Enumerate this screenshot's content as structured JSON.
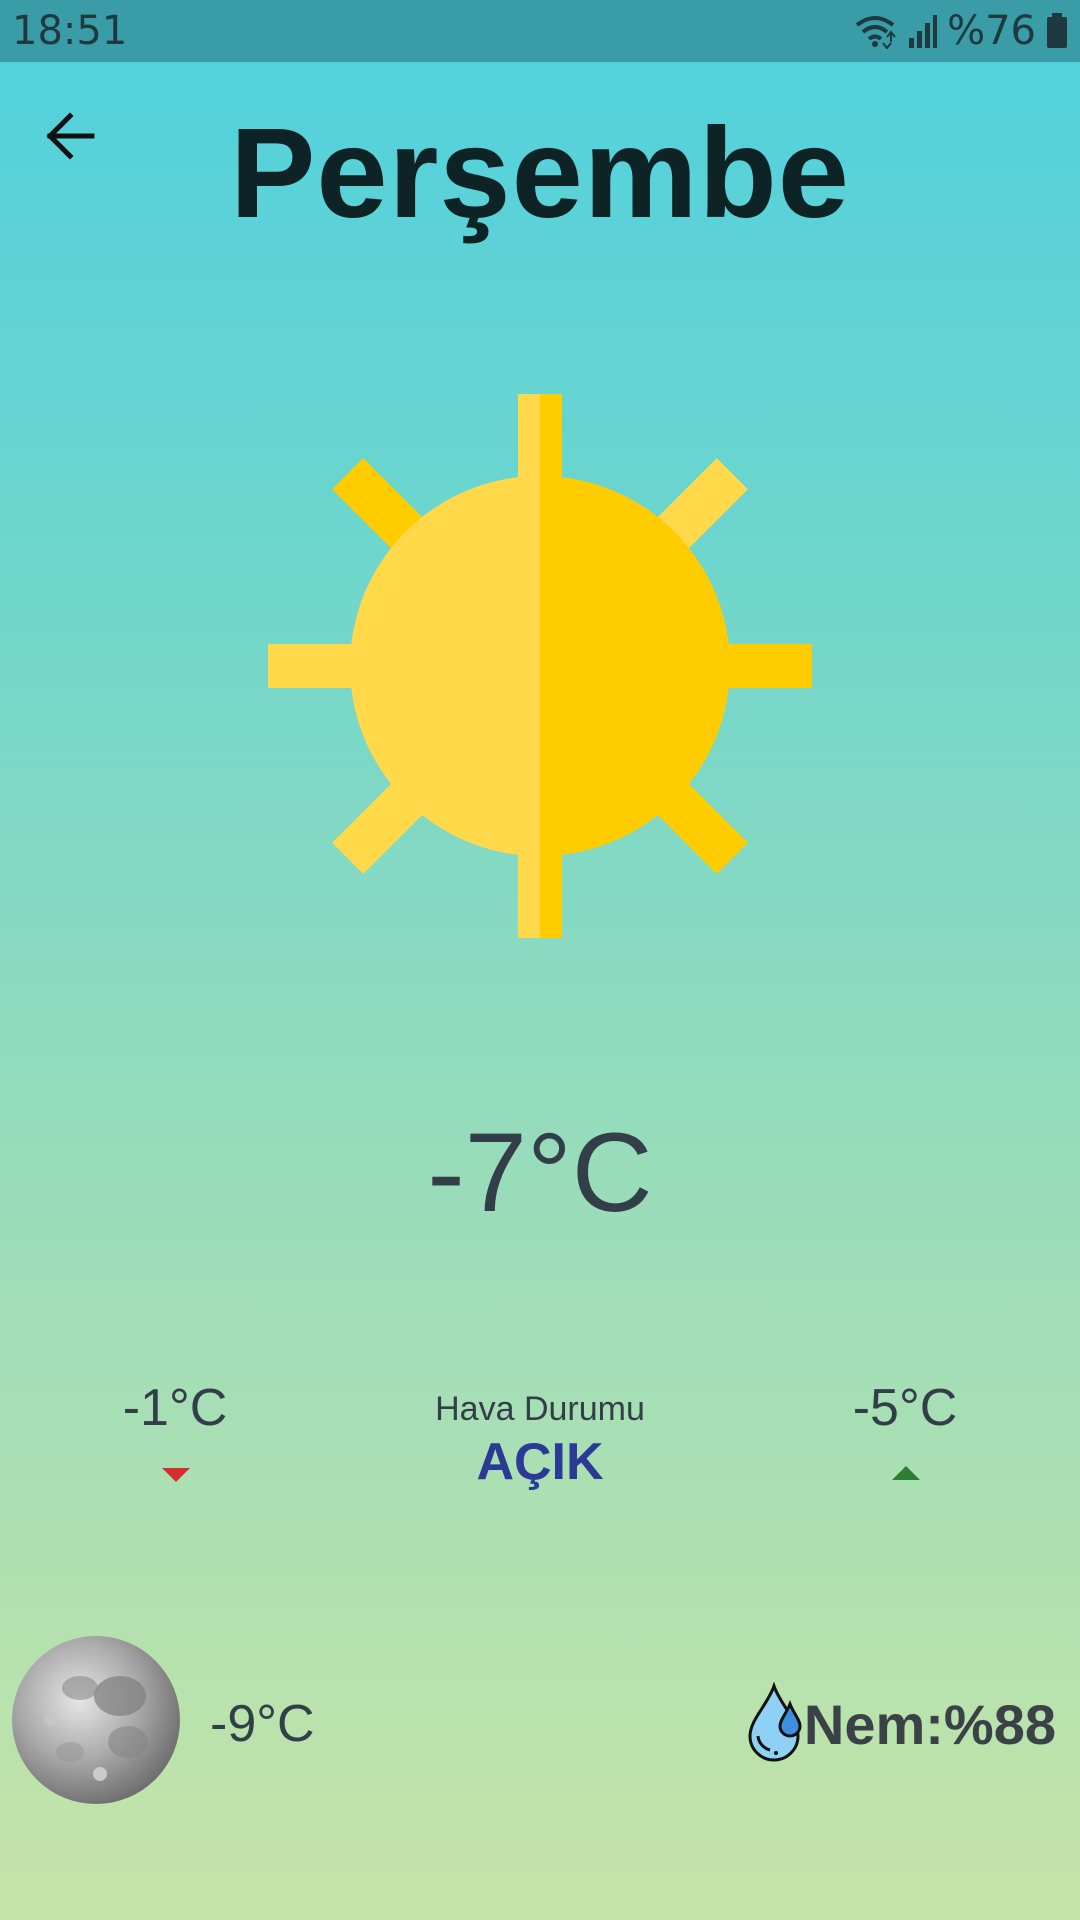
{
  "status_bar": {
    "time": "18:51",
    "battery": "%76",
    "icons": [
      "wifi-icon",
      "signal-icon",
      "battery-icon"
    ]
  },
  "header": {
    "back_icon": "arrow-left-icon",
    "day": "Perşembe"
  },
  "weather": {
    "icon": "sun-icon",
    "current_temp": "-7°C",
    "low_temp": "-1°C",
    "high_temp": "-5°C",
    "label": "Hava Durumu",
    "condition": "AÇIK",
    "night_temp": "-9°C",
    "humidity": "Nem:%88"
  },
  "colors": {
    "sun_light": "#ffd94a",
    "sun_dark": "#ffcc00",
    "low_arrow": "#d32f2f",
    "high_arrow": "#2e7d32",
    "condition": "#2b3a94"
  }
}
